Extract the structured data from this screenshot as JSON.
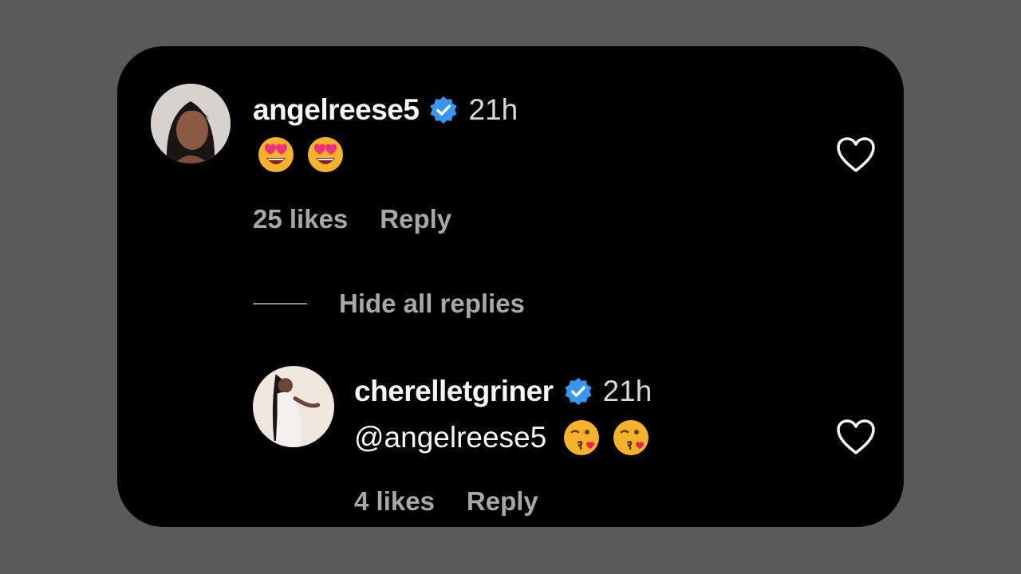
{
  "comments": [
    {
      "username": "angelreese5",
      "verified_icon": "verified-badge-icon",
      "time": "21h",
      "text": "",
      "emojis": [
        "smiling-face-with-heart-eyes-icon",
        "smiling-face-with-heart-eyes-icon"
      ],
      "likes": "25 likes",
      "reply_label": "Reply"
    },
    {
      "username": "cherelletgriner",
      "verified_icon": "verified-badge-icon",
      "time": "21h",
      "text": "@angelreese5",
      "emojis": [
        "face-blowing-a-kiss-icon",
        "face-blowing-a-kiss-icon"
      ],
      "likes": "4 likes",
      "reply_label": "Reply"
    }
  ],
  "hide_replies_label": "Hide all replies",
  "colors": {
    "background": "#5a5a5a",
    "card": "#000000",
    "verified": "#3797f0",
    "muted_text": "#a8a8a8"
  }
}
